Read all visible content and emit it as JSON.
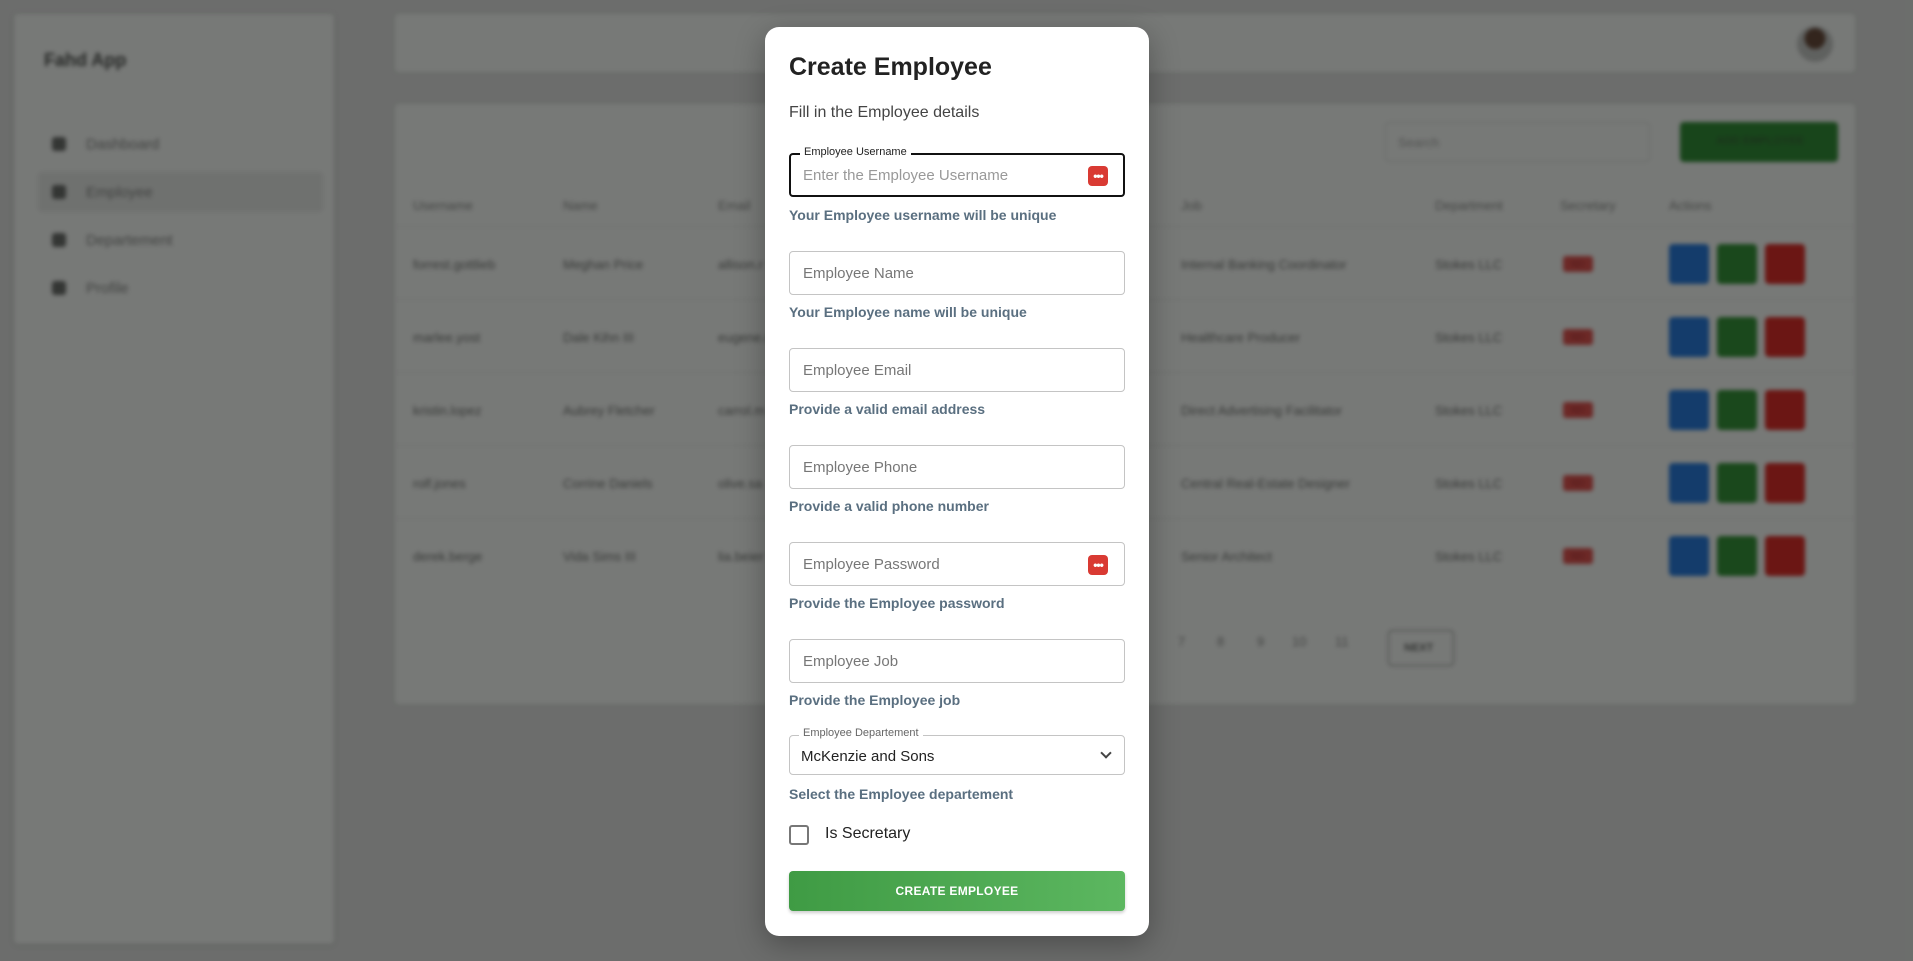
{
  "app": {
    "brand": "Fahd App",
    "nav": [
      "Dashboard",
      "Employee",
      "Departement",
      "Profile"
    ],
    "search_placeholder": "Search",
    "add_button": "ADD EMPLOYEE",
    "table_headers": [
      "Username",
      "Name",
      "Email",
      "Job",
      "Department",
      "Secretary",
      "Actions"
    ],
    "rows": [
      {
        "username": "forrest.gottlieb",
        "name": "Meghan Price",
        "email": "allison.r",
        "job": "Internal Banking Coordinator",
        "department": "Stokes LLC",
        "secretary": "NO"
      },
      {
        "username": "marlee.yost",
        "name": "Dale Kihn III",
        "email": "eugene.n",
        "job": "Healthcare Producer",
        "department": "Stokes LLC",
        "secretary": "NO"
      },
      {
        "username": "kristin.lopez",
        "name": "Aubrey Fletcher",
        "email": "carrol.m",
        "job": "Direct Advertising Facilitator",
        "department": "Stokes LLC",
        "secretary": "NO"
      },
      {
        "username": "rolf.jones",
        "name": "Corrine Daniels",
        "email": "olive.sa",
        "job": "Central Real-Estate Designer",
        "department": "Stokes LLC",
        "secretary": "NO"
      },
      {
        "username": "derek.berge",
        "name": "Vida Sims III",
        "email": "lia.beier",
        "job": "Senior Architect",
        "department": "Stokes LLC",
        "secretary": "NO"
      }
    ],
    "pages": [
      "7",
      "8",
      "9",
      "10",
      "11"
    ],
    "next_label": "NEXT"
  },
  "modal": {
    "title": "Create Employee",
    "subtitle": "Fill in the Employee details",
    "username": {
      "label": "Employee Username",
      "placeholder": "Enter the Employee Username",
      "helper": "Your Employee username will be unique"
    },
    "name": {
      "placeholder": "Employee Name",
      "helper": "Your Employee name will be unique"
    },
    "email": {
      "placeholder": "Employee Email",
      "helper": "Provide a valid email address"
    },
    "phone": {
      "placeholder": "Employee Phone",
      "helper": "Provide a valid phone number"
    },
    "password": {
      "placeholder": "Employee Password",
      "helper": "Provide the Employee password"
    },
    "job": {
      "placeholder": "Employee Job",
      "helper": "Provide the Employee job"
    },
    "department": {
      "label": "Employee Departement",
      "value": "McKenzie and Sons",
      "helper": "Select the Employee departement"
    },
    "secretary_label": "Is Secretary",
    "submit": "CREATE EMPLOYEE"
  },
  "colors": {
    "accent_green": "#4caf50",
    "icon_red": "#d93a33",
    "helper_text": "#5a6f80"
  }
}
